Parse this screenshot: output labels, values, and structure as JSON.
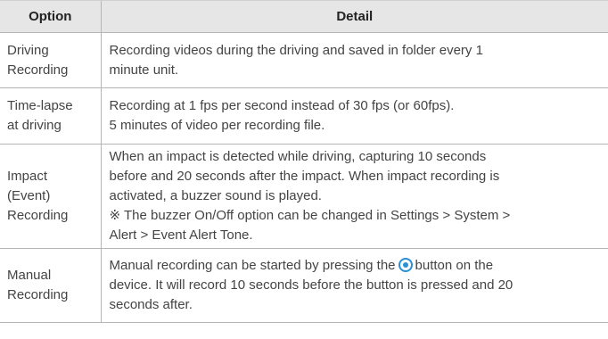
{
  "header": {
    "option": "Option",
    "detail": "Detail"
  },
  "rows": [
    {
      "option": [
        "Driving",
        "Recording"
      ],
      "detail": [
        "Recording videos during the driving and saved in folder every 1",
        "minute unit."
      ]
    },
    {
      "option": [
        "Time-lapse",
        "at driving"
      ],
      "detail": [
        "Recording at 1 fps per second instead of 30 fps (or 60fps).",
        "5 minutes of video per recording file."
      ]
    },
    {
      "option": [
        "Impact",
        "(Event)",
        "Recording"
      ],
      "detail": [
        "When an impact is detected while driving, capturing 10 seconds",
        "before and 20 seconds after the impact. When impact recording is",
        "activated, a buzzer sound is played.",
        "※ The buzzer On/Off option can be changed in Settings > System >",
        "Alert > Event Alert Tone."
      ]
    },
    {
      "option": [
        "Manual",
        "Recording"
      ],
      "detail_l1_before": "Manual recording can be started by pressing the",
      "detail_l1_after": "button on the",
      "detail_rest": [
        "device. It will record 10 seconds before the button is pressed and 20",
        "seconds after."
      ],
      "icon": "record-button-icon"
    }
  ],
  "colors": {
    "header_bg": "#e6e6e6",
    "border": "#b5b5b5",
    "text": "#444444",
    "icon": "#2a8fd6"
  }
}
